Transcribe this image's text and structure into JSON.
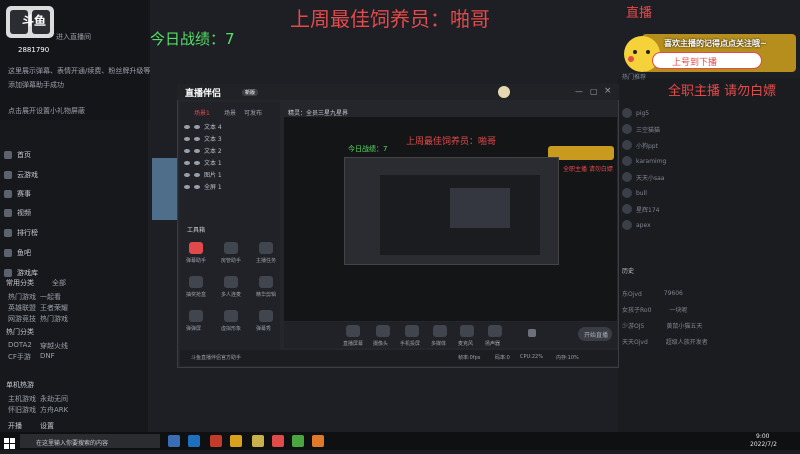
{
  "overlay": {
    "title_banner": "上周最佳饲养员：啪哥",
    "today_record": "今日战绩：7",
    "live_text": "直播",
    "fulltime_notice": "全职主播  请勿白嫖",
    "follow_banner": "喜欢主播的记得点点关注哦~",
    "follow_pill": "上号到下播"
  },
  "app": {
    "logo_text": "斗鱼",
    "viewer_count": "2881790",
    "chat_lines": [
      "进入直播间",
      "这里展示弹幕、表情开通/续费、粉丝牌升级等",
      "添加弹幕助手成功",
      "点击展开设置小礼物屏蔽"
    ],
    "nav_items": [
      {
        "label": "首页",
        "icon": "home-icon"
      },
      {
        "label": "云游戏",
        "icon": "cloud-game-icon"
      },
      {
        "label": "赛事",
        "icon": "trophy-icon"
      },
      {
        "label": "视频",
        "icon": "video-icon"
      },
      {
        "label": "排行榜",
        "icon": "rank-icon"
      },
      {
        "label": "鱼吧",
        "icon": "fish-bar-icon"
      },
      {
        "label": "游戏库",
        "icon": "game-library-icon"
      }
    ],
    "section_common": "常用分类",
    "section_more": "全部",
    "category_rows": [
      [
        "热门游戏",
        "一起看"
      ],
      [
        "英雄联盟",
        "王者荣耀"
      ],
      [
        "网游竞技",
        "热门游戏"
      ],
      [
        "DOTA2",
        "穿越火线"
      ],
      [
        "CF手游",
        "DNF"
      ]
    ],
    "section_hot": "热门分类",
    "section_single": "单机热游",
    "single_rows": [
      [
        "主机游戏",
        "永劫无间"
      ],
      [
        "怀旧游戏",
        "方舟ARK"
      ]
    ],
    "bottom_tabs": [
      "开播",
      "设置"
    ]
  },
  "obs": {
    "title": "直播伴侣",
    "version_badge": "新版",
    "stream_title_label": "精灵：全员三星九星界",
    "tabs": [
      "场景1",
      "场景",
      "可发布"
    ],
    "sources": [
      "文本 4",
      "文本 3",
      "文本 2",
      "文本 1",
      "图片 1",
      "全屏 1"
    ],
    "tools_header": "工具箱",
    "tools": [
      {
        "label": "弹幕助手",
        "icon": "danmaku-icon"
      },
      {
        "label": "房管助手",
        "icon": "room-admin-icon"
      },
      {
        "label": "主播任务",
        "icon": "task-icon"
      },
      {
        "label": "抽奖抢盒",
        "icon": "lottery-icon"
      },
      {
        "label": "多人连麦",
        "icon": "multi-mic-icon"
      },
      {
        "label": "精华剪辑",
        "icon": "clip-icon"
      },
      {
        "label": "弹弹屏",
        "icon": "danmu-screen-icon"
      },
      {
        "label": "虚拟形象",
        "icon": "avatar-icon"
      },
      {
        "label": "弹幕秀",
        "icon": "show-icon"
      }
    ],
    "bottom_buttons": [
      {
        "label": "直播屏幕",
        "icon": "screen-icon"
      },
      {
        "label": "摄像头",
        "icon": "camera-icon"
      },
      {
        "label": "手机投屏",
        "icon": "phone-cast-icon"
      },
      {
        "label": "多媒体",
        "icon": "media-icon"
      },
      {
        "label": "麦克风",
        "icon": "mic-icon"
      },
      {
        "label": "扬声器",
        "icon": "speaker-icon"
      }
    ],
    "start_button": "开始直播",
    "status_line": "斗鱼直播伴侣官方助手",
    "stats": [
      "帧率:0fps",
      "码率:0",
      "CPU:22%",
      "内存:10%"
    ]
  },
  "right_sidebar": {
    "header": "热门推荐",
    "items": [
      "pig5",
      "三空猫猫",
      "小狗ppt",
      "karamimg",
      "天天小saa",
      "bull",
      "星辉174",
      "apex"
    ],
    "history_header": "历史",
    "history": [
      [
        "东Ojvd",
        "79606"
      ],
      [
        "女孩子Ro0",
        "一块呢"
      ],
      [
        "少游OJ5",
        "黄鼠小猫五天"
      ],
      [
        "天天Ojvd",
        "超级人族开发者"
      ]
    ]
  },
  "taskbar": {
    "search_placeholder": "在这里输入你要搜索的内容",
    "time": "9:00",
    "date": "2022/7/2"
  },
  "colors": {
    "accent_red": "#e34a4a",
    "record_green": "#55e066",
    "banner_yellow": "#f5d23a"
  }
}
